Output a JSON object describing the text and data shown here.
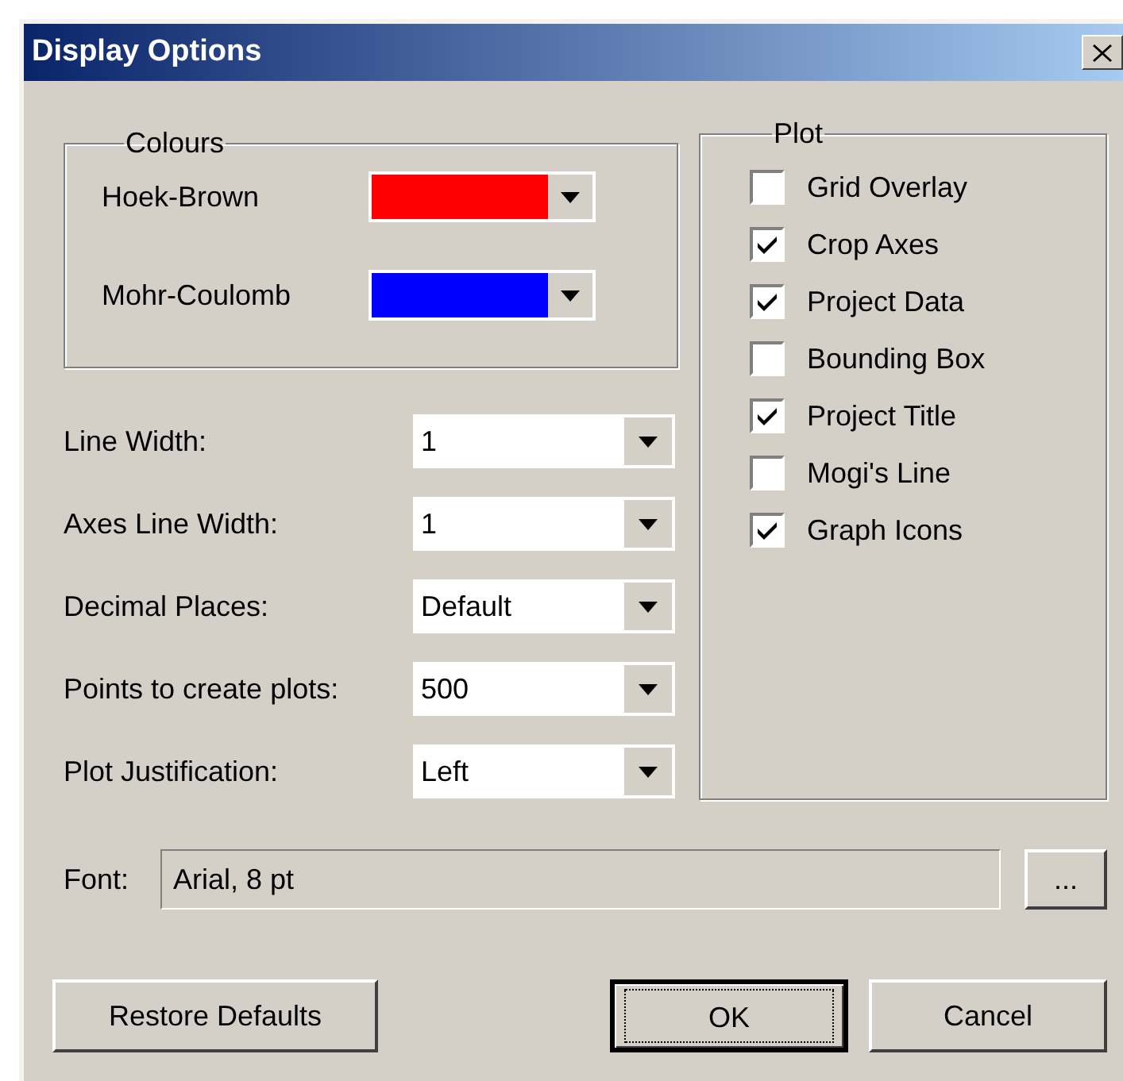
{
  "window": {
    "title": "Display Options"
  },
  "colours": {
    "title": "Colours",
    "items": [
      {
        "label": "Hoek-Brown",
        "color": "#ff0000"
      },
      {
        "label": "Mohr-Coulomb",
        "color": "#0000ff"
      }
    ]
  },
  "settings": [
    {
      "label": "Line Width:",
      "value": "1"
    },
    {
      "label": "Axes Line Width:",
      "value": "1"
    },
    {
      "label": "Decimal Places:",
      "value": "Default"
    },
    {
      "label": "Points to create plots:",
      "value": "500"
    },
    {
      "label": "Plot Justification:",
      "value": "Left"
    }
  ],
  "plot": {
    "title": "Plot",
    "options": [
      {
        "label": "Grid Overlay",
        "checked": false
      },
      {
        "label": "Crop Axes",
        "checked": true
      },
      {
        "label": "Project Data",
        "checked": true
      },
      {
        "label": "Bounding Box",
        "checked": false
      },
      {
        "label": "Project Title",
        "checked": true
      },
      {
        "label": "Mogi's Line",
        "checked": false
      },
      {
        "label": "Graph Icons",
        "checked": true
      }
    ]
  },
  "font": {
    "label": "Font:",
    "value": "Arial, 8 pt",
    "button": "..."
  },
  "buttons": [
    {
      "label": "Restore Defaults",
      "default": false
    },
    {
      "label": "OK",
      "default": true
    },
    {
      "label": "Cancel",
      "default": false
    }
  ]
}
